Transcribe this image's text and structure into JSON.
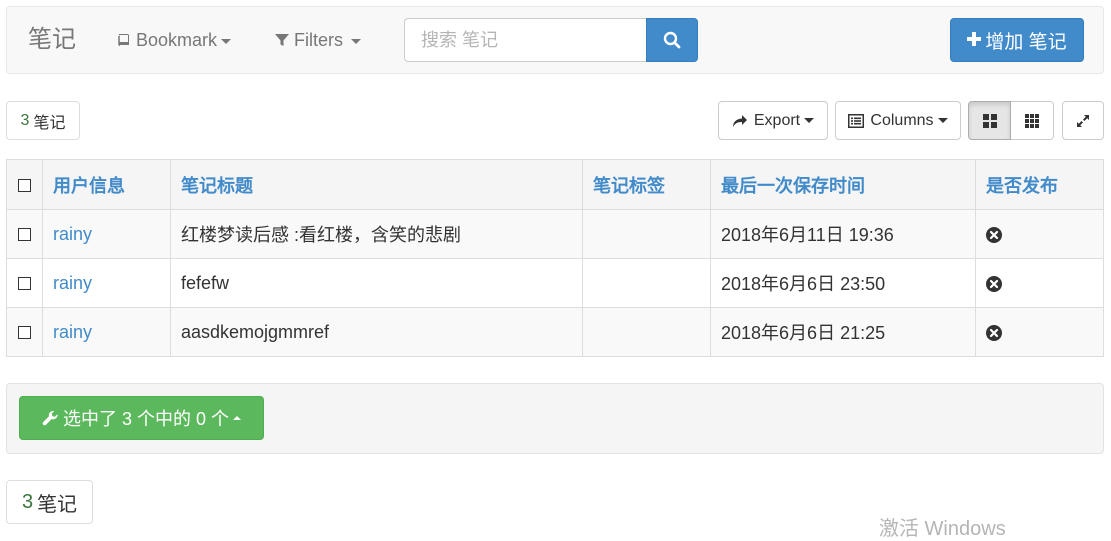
{
  "navbar": {
    "brand": "笔记",
    "bookmark_label": "Bookmark",
    "filters_label": "Filters",
    "search_placeholder": "搜索 笔记",
    "add_label": "增加 笔记"
  },
  "toolbar": {
    "count_num": "3",
    "count_label": "笔记",
    "export_label": "Export",
    "columns_label": "Columns"
  },
  "table": {
    "headers": [
      "用户信息",
      "笔记标题",
      "笔记标签",
      "最后一次保存时间",
      "是否发布"
    ],
    "rows": [
      {
        "user": "rainy",
        "title": "红楼梦读后感 :看红楼，含笑的悲剧",
        "tags": "",
        "saved": "2018年6月11日 19:36"
      },
      {
        "user": "rainy",
        "title": "fefefw",
        "tags": "",
        "saved": "2018年6月6日 23:50"
      },
      {
        "user": "rainy",
        "title": "aasdkemojgmmref",
        "tags": "",
        "saved": "2018年6月6日 21:25"
      }
    ]
  },
  "bulk": {
    "label": "选中了 3 个中的 0 个"
  },
  "footer": {
    "count_num": "3",
    "count_label": "笔记"
  },
  "watermark": "激活 Windows",
  "colors": {
    "primary": "#428bca",
    "success": "#5cb85c",
    "count_green": "#3c763d"
  }
}
